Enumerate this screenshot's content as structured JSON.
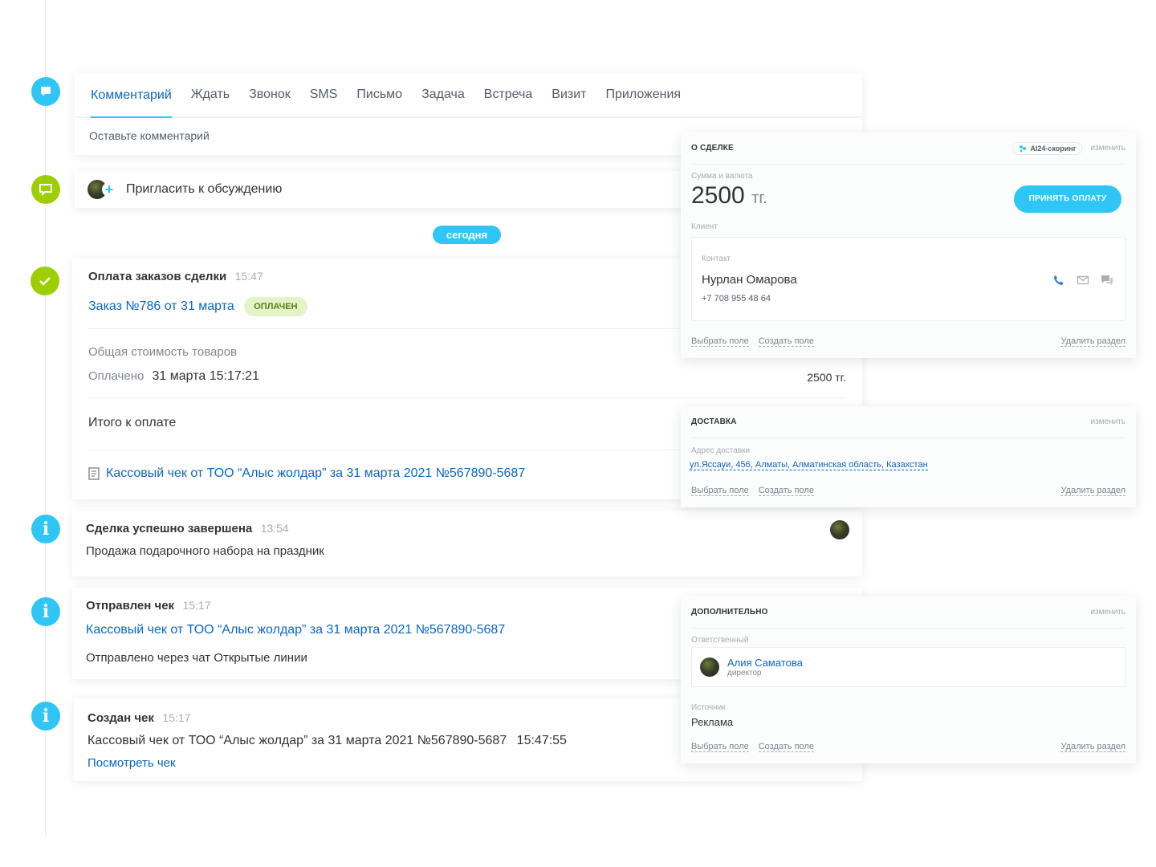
{
  "editor": {
    "tabs": [
      "Комментарий",
      "Ждать",
      "Звонок",
      "SMS",
      "Письмо",
      "Задача",
      "Встреча",
      "Визит",
      "Приложения"
    ],
    "placeholder": "Оставьте комментарий"
  },
  "invite": {
    "label": "Пригласить к обсуждению"
  },
  "today": "сегодня",
  "payment": {
    "title": "Оплата заказов сделки",
    "time": "15:47",
    "order_link": "Заказ №786 от 31 марта",
    "status": "ОПЛАЧЕН",
    "total_label": "Общая стоимость товаров",
    "paid_label": "Оплачено",
    "paid_date": "31 марта 15:17:21",
    "paid_amount": "2500 тг.",
    "due_label": "Итого к оплате",
    "receipt_link": "Кассовый чек от ТОО “Алыс жолдар” за 31 марта 2021 №567890-5687"
  },
  "deal_done": {
    "title": "Сделка успешно завершена",
    "time": "13:54",
    "text": "Продажа подарочного набора на праздник"
  },
  "receipt_sent": {
    "title": "Отправлен чек",
    "time": "15:17",
    "link": "Кассовый чек от ТОО “Алыс жолдар” за 31 марта 2021 №567890-5687",
    "text": "Отправлено через чат Открытые линии"
  },
  "receipt_created": {
    "title": "Создан чек",
    "time": "15:17",
    "text": "Кассовый чек от ТОО “Алыс жолдар” за 31 марта 2021 №567890-5687",
    "text_time": "15:47:55",
    "link": "Посмотреть чек"
  },
  "about_deal": {
    "title": "О СДЕЛКЕ",
    "ai": "AI24-скоринг",
    "edit": "изменить",
    "amount_label": "Сумма и валюта",
    "amount": "2500",
    "currency": "тг.",
    "pay_button": "ПРИНЯТЬ ОПЛАТУ",
    "client_label": "Клиент",
    "contact_label": "Контакт",
    "contact_name": "Нурлан Омарова",
    "contact_phone": "+7 708 955 48 64",
    "select_field": "Выбрать поле",
    "create_field": "Создать поле",
    "delete_section": "Удалить раздел"
  },
  "delivery": {
    "title": "ДОСТАВКА",
    "edit": "изменить",
    "address_label": "Адрес доставки",
    "address": "ул.Яссауи, 456, Алматы, Алматинская область, Казахстан",
    "select_field": "Выбрать поле",
    "create_field": "Создать поле",
    "delete_section": "Удалить раздел"
  },
  "extra": {
    "title": "ДОПОЛНИТЕЛЬНО",
    "edit": "изменить",
    "resp_label": "Ответственный",
    "resp_name": "Алия Саматова",
    "resp_role": "директор",
    "source_label": "Источник",
    "source": "Реклама",
    "select_field": "Выбрать поле",
    "create_field": "Создать поле",
    "delete_section": "Удалить раздел"
  },
  "colors": {
    "accent": "#2fc6f6",
    "link": "#0b66c3",
    "green": "#9dcf00"
  }
}
